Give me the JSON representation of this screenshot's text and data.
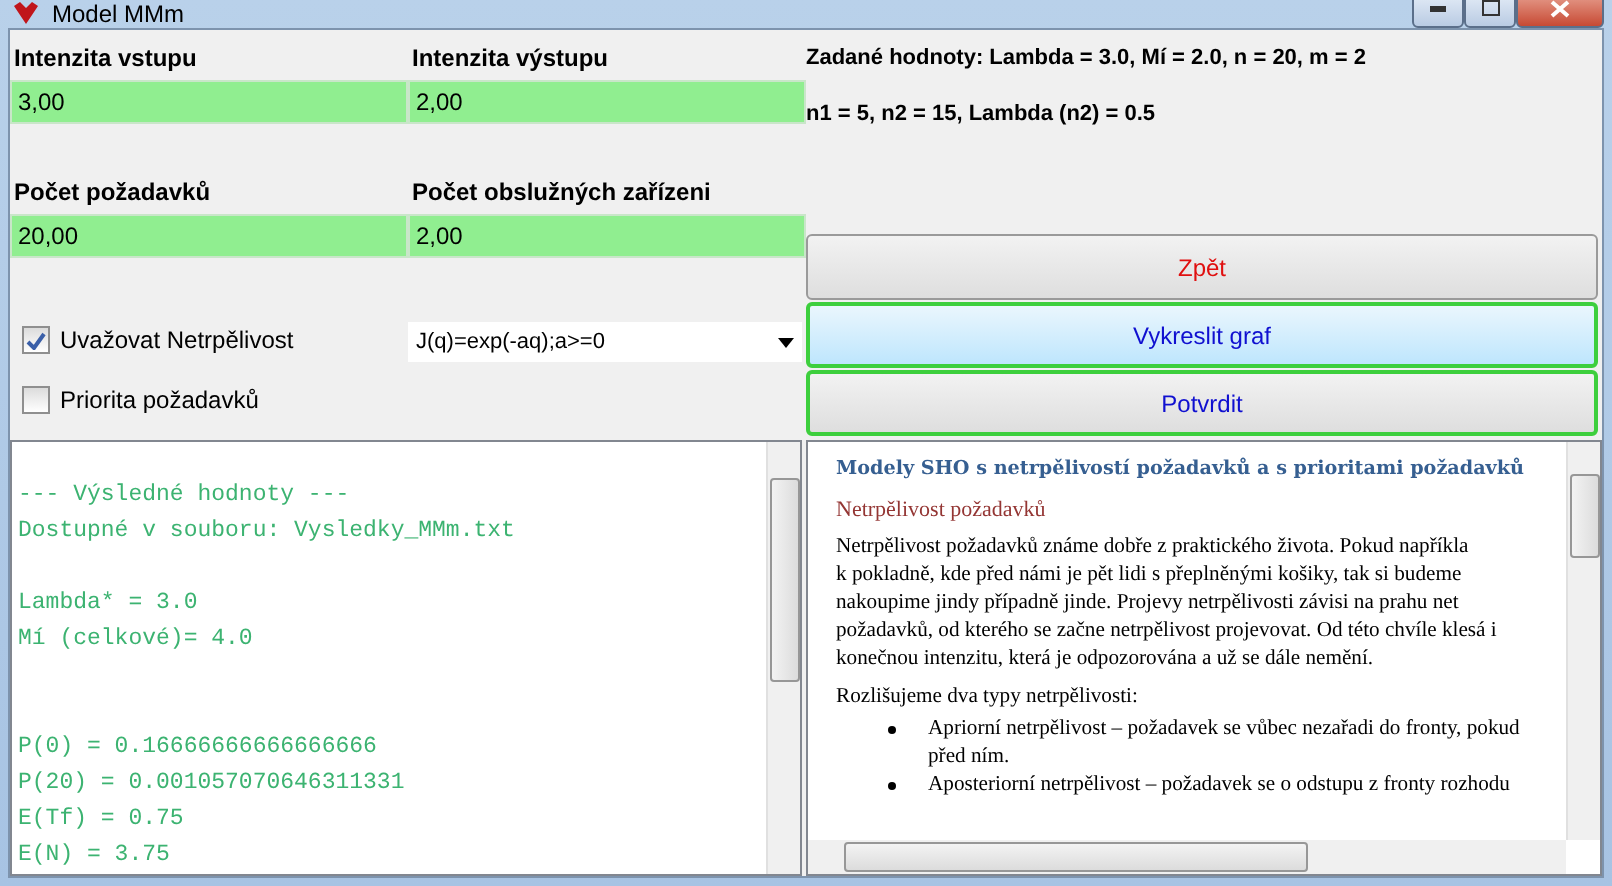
{
  "window": {
    "title": "Model MMm"
  },
  "inputs": [
    {
      "label": "Intenzita vstupu",
      "value": "3,00"
    },
    {
      "label": "Intenzita výstupu",
      "value": "2,00"
    },
    {
      "label": "Počet požadavků",
      "value": "20,00"
    },
    {
      "label": "Počet obslužných zařízeni",
      "value": "2,00"
    }
  ],
  "info": [
    "Zadané hodnoty: Lambda = 3.0, Mí = 2.0, n = 20, m = 2",
    "n1 = 5, n2 = 15, Lambda (n2) = 0.5"
  ],
  "checkboxes": [
    {
      "label": "Uvažovat Netrpělivost",
      "checked": true
    },
    {
      "label": "Priorita požadavků",
      "checked": false
    }
  ],
  "function_select": {
    "value": "J(q)=exp(-aq);a>=0"
  },
  "buttons": [
    {
      "label": "Zpět",
      "kind": "back",
      "selected": false
    },
    {
      "label": "Vykreslit graf",
      "kind": "action",
      "selected": true
    },
    {
      "label": "Potvrdit",
      "kind": "action",
      "selected": false
    }
  ],
  "output_blocks": [
    [
      "--- Výsledné hodnoty ---",
      "Dostupné v souboru: Vysledky_MMm.txt"
    ],
    [
      "Lambda* = 3.0",
      "Mí (celkové)= 4.0"
    ],
    [
      "P(0) = 0.16666666666666666",
      "P(20) = 0.001057070646311331",
      "E(Tf) = 0.75",
      "E(N) = 3.75"
    ]
  ],
  "help": {
    "title": "Modely SHO s netrpělivostí  požadavků a s prioritami  požadavků",
    "subtitle": "Netrpělivost požadavků",
    "paragraph_lines": [
      "Netrpělivost požadavků známe dobře z praktického života. Pokud napříkla",
      "k pokladně, kde před námi je pět lidi s přeplněnými košiky, tak si budeme",
      "nakoupime jindy případně jinde. Projevy netrpělivosti závisi na prahu net",
      "požadavků, od kterého se začne netrpělivost projevovat. Od této chvíle klesá i",
      "konečnou intenzitu, která je odpozorována a už se dále nemění."
    ],
    "intro": "Rozlišujeme dva typy netrpělivosti:",
    "bullets": [
      [
        "Apriorní netrpělivost – požadavek se vůbec nezařadi do fronty, pokud",
        "před ním."
      ],
      [
        "Aposteriorní netrpělivost – požadavek se o odstupu z fronty rozhodu"
      ]
    ]
  }
}
